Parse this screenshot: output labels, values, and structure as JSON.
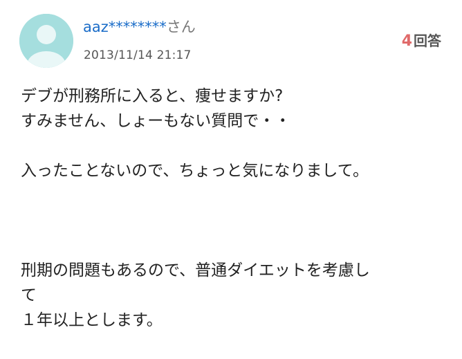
{
  "user": {
    "name": "aaz********",
    "honorific": "さん",
    "avatar_icon": "default-user-avatar-icon",
    "avatar_color": "#a5dede"
  },
  "post": {
    "timestamp": "2013/11/14 21:17"
  },
  "answers": {
    "count": "4",
    "label": "回答",
    "count_color": "#e06a6a"
  },
  "question": {
    "lines": [
      "デブが刑務所に入ると、痩せますか?",
      "すみません、しょーもない質問で・・",
      "",
      "入ったことないので、ちょっと気になりまして。",
      "",
      "",
      "",
      "刑期の問題もあるので、普通ダイエットを考慮し",
      "て",
      "１年以上とします。"
    ]
  },
  "colors": {
    "link": "#1a6cc8",
    "text": "#222222",
    "muted": "#777777"
  }
}
